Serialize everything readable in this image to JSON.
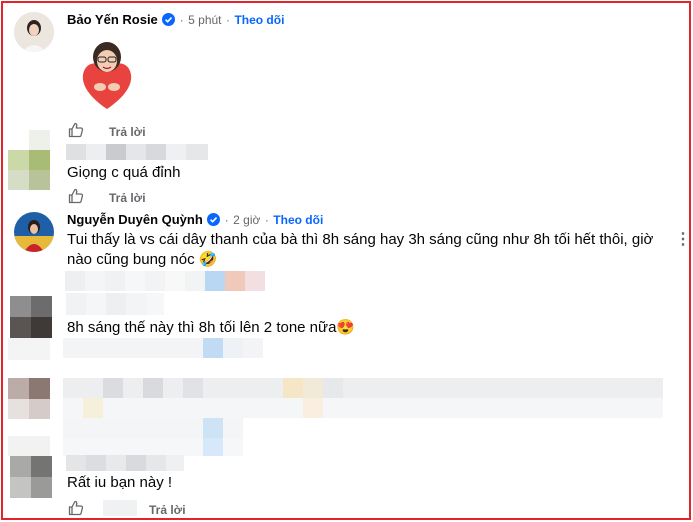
{
  "comments": [
    {
      "author": "Bảo Yến Rosie",
      "time": "5 phút",
      "separator": "·",
      "follow": "Theo dõi",
      "reply": "Trả lời"
    },
    {
      "text": "Giọng c quá đỉnh",
      "reply": "Trả lời"
    },
    {
      "author": "Nguyễn Duyên Quỳnh",
      "time": "2 giờ",
      "separator": "·",
      "follow": "Theo dõi",
      "text_line1": "Tui thấy là vs cái dây thanh của bà thì 8h sáng hay 3h sáng cũng như 8h tối hết thôi, giờ",
      "text_line2": "nào cũng bung nóc 🤣",
      "more": "⋮"
    },
    {
      "text": "8h sáng thế này thì 8h tối lên 2 tone nữa😍"
    },
    {
      "text": "Rất iu bạn này !",
      "reply": "Trả lời"
    }
  ],
  "icons": [
    "verified-badge-icon",
    "like-icon",
    "more-options-icon",
    "heart-sticker"
  ],
  "colors": {
    "border": "#e0262b",
    "link": "#0866ff",
    "meta": "#65676b",
    "verified": "#0866ff"
  }
}
